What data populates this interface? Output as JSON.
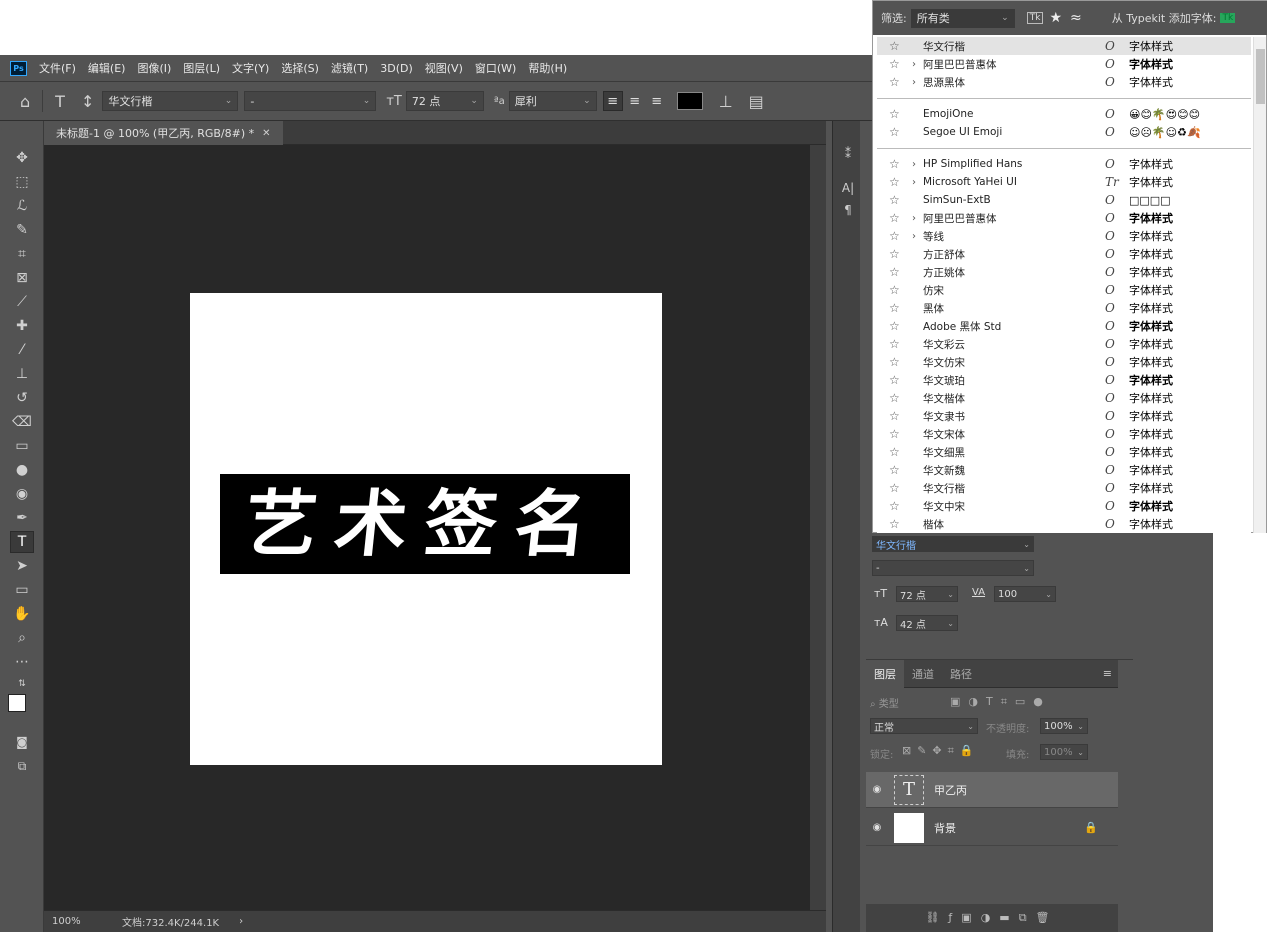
{
  "menu": {
    "logo": "Ps",
    "items": [
      "文件(F)",
      "编辑(E)",
      "图像(I)",
      "图层(L)",
      "文字(Y)",
      "选择(S)",
      "滤镜(T)",
      "3D(D)",
      "视图(V)",
      "窗口(W)",
      "帮助(H)"
    ]
  },
  "options": {
    "font_family": "华文行楷",
    "font_style": "-",
    "font_size": "72 点",
    "aa_label": "ªa",
    "anti_alias": "犀利",
    "text_color": "#000000"
  },
  "document": {
    "tab_title": "未标题-1 @ 100% (甲乙丙, RGB/8#) *",
    "canvas_text": "艺术签名"
  },
  "status": {
    "zoom": "100%",
    "doc_info": "文档:732.4K/244.1K"
  },
  "font_panel": {
    "filter_label": "筛选:",
    "filter_value": "所有类",
    "typekit_label": "从 Typekit 添加字体:",
    "groups": [
      [
        {
          "name": "华文行楷",
          "chev": false,
          "type": "O",
          "sample": "字体样式",
          "selected": true
        },
        {
          "name": "阿里巴巴普惠体",
          "chev": true,
          "type": "O",
          "sample": "字体样式",
          "bold": true
        },
        {
          "name": "思源黑体",
          "chev": true,
          "type": "O",
          "sample": "字体样式"
        }
      ],
      [
        {
          "name": "EmojiOne",
          "chev": false,
          "type": "O",
          "sample": "😀😊🌴😍😊😊"
        },
        {
          "name": "Segoe UI Emoji",
          "chev": false,
          "type": "O",
          "sample": "☺☹🌴☺♻🍂"
        }
      ],
      [
        {
          "name": "HP Simplified Hans",
          "chev": true,
          "type": "O",
          "sample": "字体样式"
        },
        {
          "name": "Microsoft YaHei UI",
          "chev": true,
          "type": "Tr",
          "sample": "字体样式"
        },
        {
          "name": "SimSun-ExtB",
          "chev": false,
          "type": "O",
          "sample": "□□□□"
        },
        {
          "name": "阿里巴巴普惠体",
          "chev": true,
          "type": "O",
          "sample": "字体样式",
          "bold": true
        },
        {
          "name": "等线",
          "chev": true,
          "type": "O",
          "sample": "字体样式"
        },
        {
          "name": "方正舒体",
          "chev": false,
          "type": "O",
          "sample": "字体样式"
        },
        {
          "name": "方正姚体",
          "chev": false,
          "type": "O",
          "sample": "字体样式"
        },
        {
          "name": "仿宋",
          "chev": false,
          "type": "O",
          "sample": "字体样式"
        },
        {
          "name": "黑体",
          "chev": false,
          "type": "O",
          "sample": "字体样式"
        },
        {
          "name": "Adobe 黑体 Std",
          "chev": false,
          "type": "O",
          "sample": "字体样式",
          "bold": true
        },
        {
          "name": "华文彩云",
          "chev": false,
          "type": "O",
          "sample": "字体样式"
        },
        {
          "name": "华文仿宋",
          "chev": false,
          "type": "O",
          "sample": "字体样式"
        },
        {
          "name": "华文琥珀",
          "chev": false,
          "type": "O",
          "sample": "字体样式",
          "bold": true
        },
        {
          "name": "华文楷体",
          "chev": false,
          "type": "O",
          "sample": "字体样式"
        },
        {
          "name": "华文隶书",
          "chev": false,
          "type": "O",
          "sample": "字体样式"
        },
        {
          "name": "华文宋体",
          "chev": false,
          "type": "O",
          "sample": "字体样式"
        },
        {
          "name": "华文细黑",
          "chev": false,
          "type": "O",
          "sample": "字体样式"
        },
        {
          "name": "华文新魏",
          "chev": false,
          "type": "O",
          "sample": "字体样式"
        },
        {
          "name": "华文行楷",
          "chev": false,
          "type": "O",
          "sample": "字体样式"
        },
        {
          "name": "华文中宋",
          "chev": false,
          "type": "O",
          "sample": "字体样式",
          "bold": true
        },
        {
          "name": "楷体",
          "chev": false,
          "type": "O",
          "sample": "字体样式"
        }
      ]
    ]
  },
  "character_panel": {
    "font_family": "华文行楷",
    "font_style": "-",
    "size": "72 点",
    "tracking": "100",
    "leading": "42 点"
  },
  "layers_panel": {
    "tabs": [
      "图层",
      "通道",
      "路径"
    ],
    "filter_placeholder": "类型",
    "blend_mode": "正常",
    "opacity_label": "不透明度:",
    "opacity": "100%",
    "lock_label": "锁定:",
    "fill_label": "填充:",
    "fill": "100%",
    "layers": [
      {
        "name": "甲乙丙",
        "kind": "text",
        "selected": true
      },
      {
        "name": "背景",
        "kind": "image",
        "locked": true
      }
    ]
  }
}
